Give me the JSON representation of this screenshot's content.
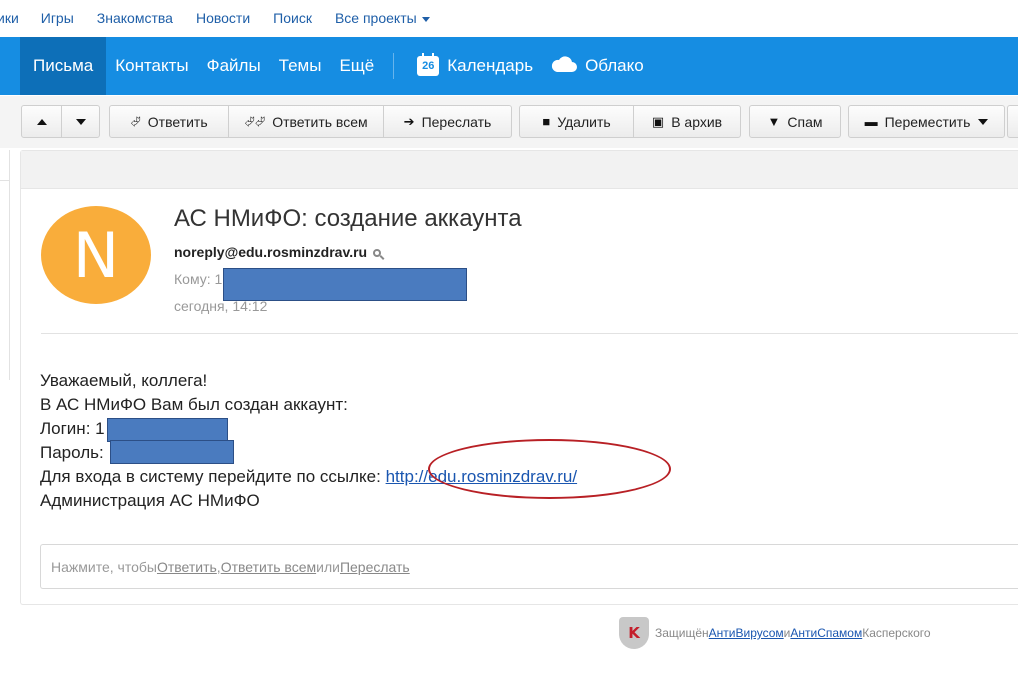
{
  "portal": {
    "links": [
      "ики",
      "Игры",
      "Знакомства",
      "Новости",
      "Поиск"
    ],
    "all_projects": "Все проекты"
  },
  "nav": {
    "items": [
      "Письма",
      "Контакты",
      "Файлы",
      "Темы",
      "Ещё"
    ],
    "calendar_day": "26",
    "calendar": "Календарь",
    "cloud": "Облако"
  },
  "toolbar": {
    "reply": "Ответить",
    "reply_all": "Ответить всем",
    "forward": "Переслать",
    "delete": "Удалить",
    "archive": "В архив",
    "spam": "Спам",
    "move": "Переместить"
  },
  "message": {
    "avatar_letter": "N",
    "subject": "АС НМиФО: создание аккаунта",
    "sender": "noreply@edu.rosminzdrav.ru",
    "to_label": "Кому:",
    "to_partial": "1",
    "date": "сегодня, 14:12",
    "greeting": "Уважаемый, коллега!",
    "line_created": "В АС НМиФО Вам был создан аккаунт:",
    "login_label": "Логин: ",
    "login_partial": "1",
    "password_label": "Пароль:",
    "link_prefix": "Для входа в систему перейдите по ссылке: ",
    "link": "http://edu.rosminzdrav.ru/",
    "signature": "Администрация АС НМиФО"
  },
  "reply_prompt": {
    "prefix": "Нажмите, чтобы ",
    "reply": "Ответить",
    "sep": ", ",
    "reply_all": "Ответить всем",
    "or": " или ",
    "forward": "Переслать"
  },
  "footer": {
    "shield_letter": "K",
    "protected": "Защищён ",
    "antivirus": "АнтиВирусом",
    "and": " и ",
    "antispam": "АнтиСпамом",
    "kaspersky": " Касперского"
  },
  "colors": {
    "nav_bg": "#168de2",
    "nav_active": "#0d6fb8",
    "avatar": "#f9ad3b",
    "redaction": "#4a7bbf",
    "highlight_ellipse": "#b82025"
  }
}
